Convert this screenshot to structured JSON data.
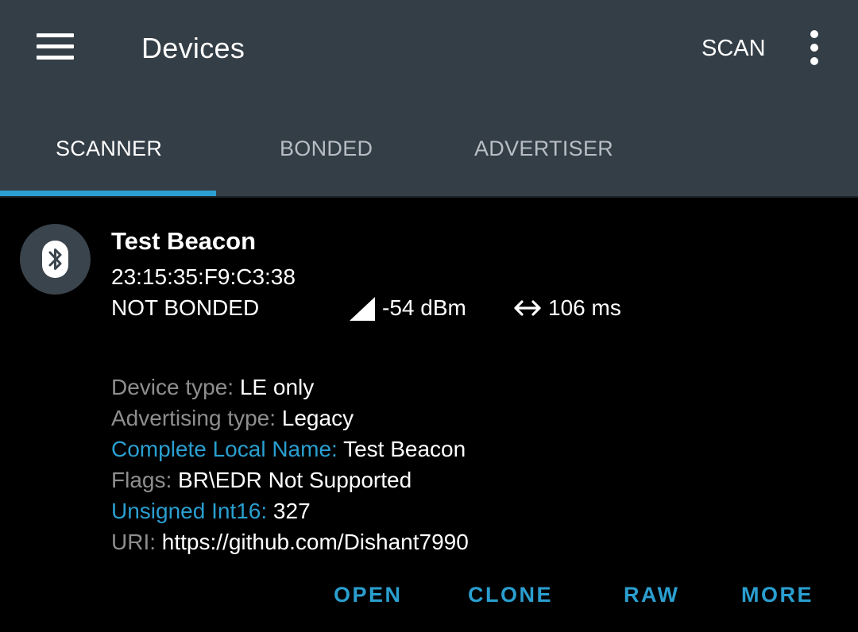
{
  "appbar": {
    "title": "Devices",
    "scan_label": "SCAN",
    "menu_icon": "hamburger-menu-icon",
    "overflow_icon": "more-vertical-icon"
  },
  "tabs": [
    {
      "label": "SCANNER",
      "active": true
    },
    {
      "label": "BONDED",
      "active": false
    },
    {
      "label": "ADVERTISER",
      "active": false
    }
  ],
  "device": {
    "icon": "bluetooth-icon",
    "name": "Test Beacon",
    "address": "23:15:35:F9:C3:38",
    "bond_state": "NOT BONDED",
    "rssi": "-54 dBm",
    "interval": "106 ms",
    "details": [
      {
        "label": "Device type:",
        "value": "LE only",
        "label_color": "gray"
      },
      {
        "label": "Advertising type:",
        "value": "Legacy",
        "label_color": "gray"
      },
      {
        "label": "Complete Local Name:",
        "value": "Test Beacon",
        "label_color": "blue"
      },
      {
        "label": "Flags:",
        "value": "BR\\EDR Not Supported",
        "label_color": "gray"
      },
      {
        "label": "Unsigned Int16:",
        "value": "327",
        "label_color": "blue"
      },
      {
        "label": "URI:",
        "value": "https://github.com/Dishant7990",
        "label_color": "gray"
      }
    ],
    "actions": [
      "OPEN",
      "CLONE",
      "RAW",
      "MORE"
    ]
  },
  "colors": {
    "appbar": "#343e47",
    "accent": "#2a9fd0",
    "background": "#000000",
    "label_gray": "#8e8e8e"
  }
}
